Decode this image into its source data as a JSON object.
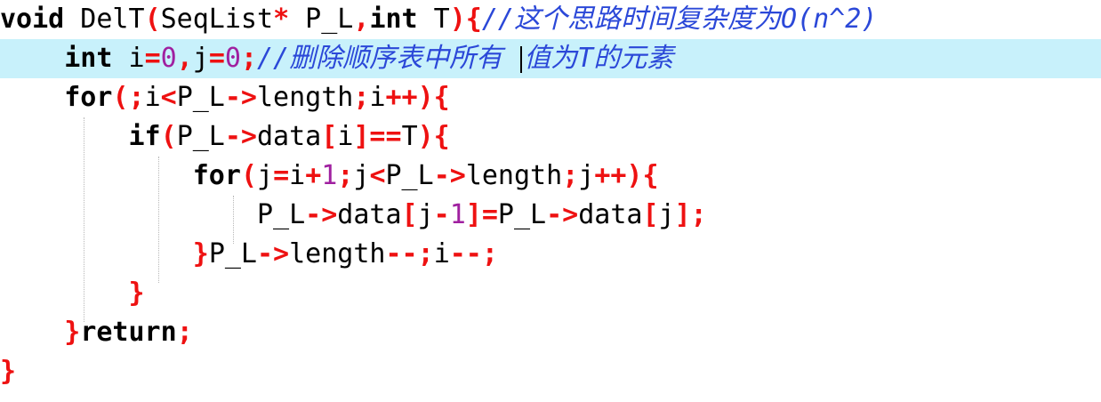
{
  "editor": {
    "lines": [
      {
        "tokens": [
          {
            "t": "void",
            "c": "kw"
          },
          {
            "t": " DelT",
            "c": "plain"
          },
          {
            "t": "(",
            "c": "op"
          },
          {
            "t": "SeqList",
            "c": "plain"
          },
          {
            "t": "*",
            "c": "op"
          },
          {
            "t": " P_L",
            "c": "plain"
          },
          {
            "t": ",",
            "c": "op"
          },
          {
            "t": "int",
            "c": "kw"
          },
          {
            "t": " T",
            "c": "plain"
          },
          {
            "t": "){",
            "c": "op"
          },
          {
            "t": "//这个思路时间复杂度为O(n^2)",
            "c": "cm"
          }
        ]
      },
      {
        "current": true,
        "tokens": [
          {
            "t": "    ",
            "c": "plain"
          },
          {
            "t": "int",
            "c": "kw"
          },
          {
            "t": " i",
            "c": "plain"
          },
          {
            "t": "=",
            "c": "op"
          },
          {
            "t": "0",
            "c": "num"
          },
          {
            "t": ",",
            "c": "op"
          },
          {
            "t": "j",
            "c": "plain"
          },
          {
            "t": "=",
            "c": "op"
          },
          {
            "t": "0",
            "c": "num"
          },
          {
            "t": ";",
            "c": "op"
          },
          {
            "t": "//删除顺序表中所有 ",
            "c": "cm"
          },
          {
            "t": "值为T的元素",
            "c": "cm"
          }
        ]
      },
      {
        "tokens": [
          {
            "t": "    ",
            "c": "plain"
          },
          {
            "t": "for",
            "c": "kw"
          },
          {
            "t": "(;",
            "c": "op"
          },
          {
            "t": "i",
            "c": "plain"
          },
          {
            "t": "<",
            "c": "op"
          },
          {
            "t": "P_L",
            "c": "plain"
          },
          {
            "t": "->",
            "c": "op"
          },
          {
            "t": "length",
            "c": "plain"
          },
          {
            "t": ";",
            "c": "op"
          },
          {
            "t": "i",
            "c": "plain"
          },
          {
            "t": "++){",
            "c": "op"
          }
        ]
      },
      {
        "tokens": [
          {
            "t": "        ",
            "c": "plain"
          },
          {
            "t": "if",
            "c": "kw"
          },
          {
            "t": "(",
            "c": "op"
          },
          {
            "t": "P_L",
            "c": "plain"
          },
          {
            "t": "->",
            "c": "op"
          },
          {
            "t": "data",
            "c": "plain"
          },
          {
            "t": "[",
            "c": "op"
          },
          {
            "t": "i",
            "c": "plain"
          },
          {
            "t": "]==",
            "c": "op"
          },
          {
            "t": "T",
            "c": "plain"
          },
          {
            "t": "){",
            "c": "op"
          }
        ]
      },
      {
        "tokens": [
          {
            "t": "            ",
            "c": "plain"
          },
          {
            "t": "for",
            "c": "kw"
          },
          {
            "t": "(",
            "c": "op"
          },
          {
            "t": "j",
            "c": "plain"
          },
          {
            "t": "=",
            "c": "op"
          },
          {
            "t": "i",
            "c": "plain"
          },
          {
            "t": "+",
            "c": "op"
          },
          {
            "t": "1",
            "c": "num"
          },
          {
            "t": ";",
            "c": "op"
          },
          {
            "t": "j",
            "c": "plain"
          },
          {
            "t": "<",
            "c": "op"
          },
          {
            "t": "P_L",
            "c": "plain"
          },
          {
            "t": "->",
            "c": "op"
          },
          {
            "t": "length",
            "c": "plain"
          },
          {
            "t": ";",
            "c": "op"
          },
          {
            "t": "j",
            "c": "plain"
          },
          {
            "t": "++){",
            "c": "op"
          }
        ]
      },
      {
        "tokens": [
          {
            "t": "                ",
            "c": "plain"
          },
          {
            "t": "P_L",
            "c": "plain"
          },
          {
            "t": "->",
            "c": "op"
          },
          {
            "t": "data",
            "c": "plain"
          },
          {
            "t": "[",
            "c": "op"
          },
          {
            "t": "j",
            "c": "plain"
          },
          {
            "t": "-",
            "c": "op"
          },
          {
            "t": "1",
            "c": "num"
          },
          {
            "t": "]=",
            "c": "op"
          },
          {
            "t": "P_L",
            "c": "plain"
          },
          {
            "t": "->",
            "c": "op"
          },
          {
            "t": "data",
            "c": "plain"
          },
          {
            "t": "[",
            "c": "op"
          },
          {
            "t": "j",
            "c": "plain"
          },
          {
            "t": "];",
            "c": "op"
          }
        ]
      },
      {
        "tokens": [
          {
            "t": "            ",
            "c": "plain"
          },
          {
            "t": "}",
            "c": "op"
          },
          {
            "t": "P_L",
            "c": "plain"
          },
          {
            "t": "->",
            "c": "op"
          },
          {
            "t": "length",
            "c": "plain"
          },
          {
            "t": "--;",
            "c": "op"
          },
          {
            "t": "i",
            "c": "plain"
          },
          {
            "t": "--;",
            "c": "op"
          }
        ]
      },
      {
        "tokens": [
          {
            "t": "        ",
            "c": "plain"
          },
          {
            "t": "}",
            "c": "op"
          }
        ]
      },
      {
        "tokens": [
          {
            "t": "    ",
            "c": "plain"
          },
          {
            "t": "}",
            "c": "op"
          },
          {
            "t": "return",
            "c": "kw"
          },
          {
            "t": ";",
            "c": "op"
          }
        ]
      },
      {
        "tokens": [
          {
            "t": "}",
            "c": "op"
          }
        ]
      }
    ]
  }
}
